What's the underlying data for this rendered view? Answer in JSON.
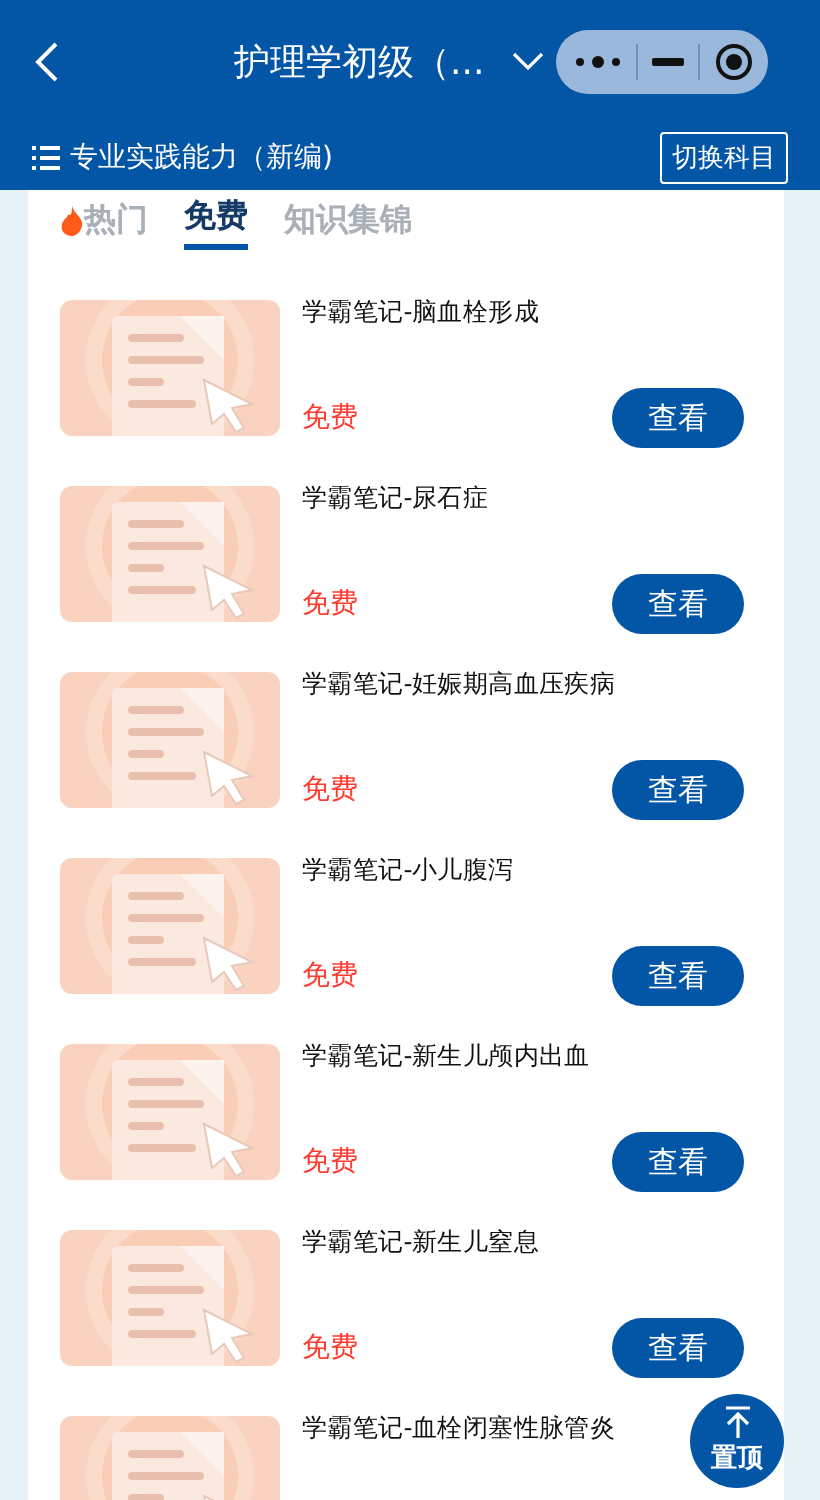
{
  "header": {
    "title": "护理学初级（...",
    "subject": "专业实践能力（新编)",
    "switch_button": "切换科目"
  },
  "tabs": [
    {
      "label": "热门",
      "kind": "hot",
      "selected": false
    },
    {
      "label": "免费",
      "kind": "plain",
      "selected": true
    },
    {
      "label": "知识集锦",
      "kind": "plain",
      "selected": false
    }
  ],
  "items": [
    {
      "title": "学霸笔记-脑血栓形成",
      "price": "免费",
      "button": "查看"
    },
    {
      "title": "学霸笔记-尿石症",
      "price": "免费",
      "button": "查看"
    },
    {
      "title": "学霸笔记-妊娠期高血压疾病",
      "price": "免费",
      "button": "查看"
    },
    {
      "title": "学霸笔记-小儿腹泻",
      "price": "免费",
      "button": "查看"
    },
    {
      "title": "学霸笔记-新生儿颅内出血",
      "price": "免费",
      "button": "查看"
    },
    {
      "title": "学霸笔记-新生儿窒息",
      "price": "免费",
      "button": "查看"
    },
    {
      "title": "学霸笔记-血栓闭塞性脉管炎"
    }
  ],
  "top_button": "置顶"
}
